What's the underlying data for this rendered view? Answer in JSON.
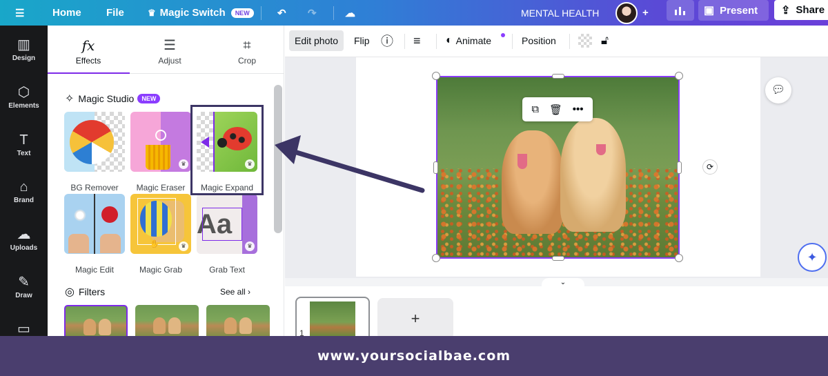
{
  "topbar": {
    "home": "Home",
    "file": "File",
    "magic_switch": "Magic Switch",
    "new_badge": "NEW",
    "doc_title": "MENTAL HEALTH",
    "present": "Present",
    "share": "Share"
  },
  "rail": {
    "items": [
      {
        "label": "Design",
        "icon": "design-icon"
      },
      {
        "label": "Elements",
        "icon": "elements-icon"
      },
      {
        "label": "Text",
        "icon": "text-icon"
      },
      {
        "label": "Brand",
        "icon": "brand-icon"
      },
      {
        "label": "Uploads",
        "icon": "uploads-icon"
      },
      {
        "label": "Draw",
        "icon": "draw-icon"
      },
      {
        "label": "",
        "icon": "projects-icon"
      }
    ]
  },
  "panel": {
    "tabs": [
      {
        "label": "Effects",
        "icon": "fx-icon"
      },
      {
        "label": "Adjust",
        "icon": "sliders-icon"
      },
      {
        "label": "Crop",
        "icon": "crop-icon"
      }
    ],
    "magic_studio": {
      "title": "Magic Studio",
      "badge": "NEW",
      "tools": [
        {
          "label": "BG Remover"
        },
        {
          "label": "Magic Eraser"
        },
        {
          "label": "Magic Expand"
        },
        {
          "label": "Magic Edit"
        },
        {
          "label": "Magic Grab"
        },
        {
          "label": "Grab Text"
        }
      ],
      "grab_text_sample": "Aa"
    },
    "filters": {
      "title": "Filters",
      "see_all": "See all"
    }
  },
  "toolbar": {
    "edit_photo": "Edit photo",
    "flip": "Flip",
    "animate": "Animate",
    "position": "Position"
  },
  "pages": {
    "current_page": "1",
    "add_symbol": "+"
  },
  "footer": {
    "watermark": "www.yoursocialbae.com"
  },
  "colors": {
    "accent": "#8b3dff",
    "annotation": "#3c3565",
    "footer_bg": "#4a3e6e"
  }
}
